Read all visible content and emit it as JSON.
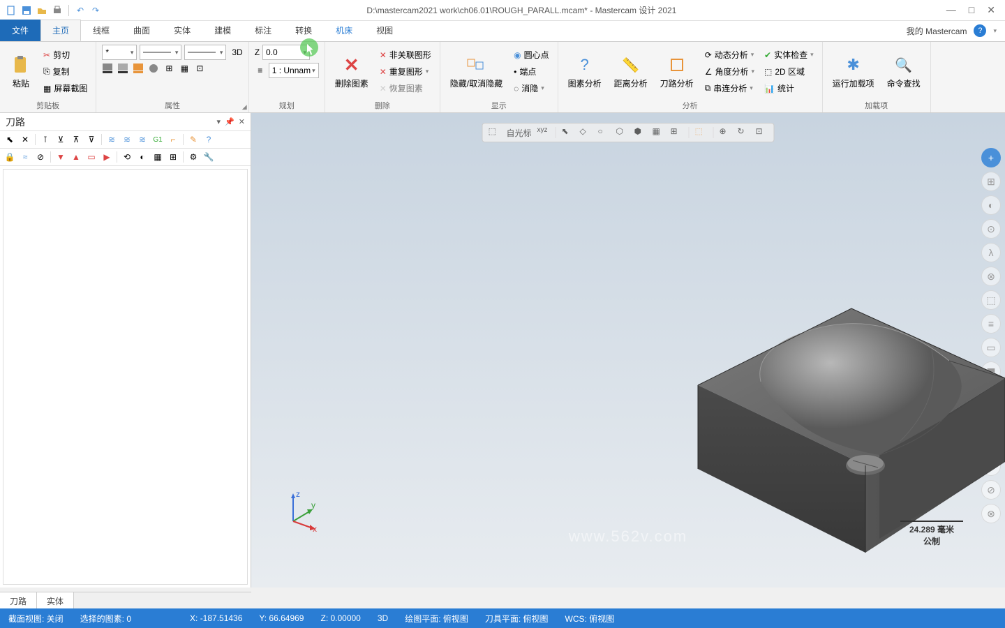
{
  "title": "D:\\mastercam2021 work\\ch06.01\\ROUGH_PARALL.mcam* - Mastercam 设计 2021",
  "qat_icons": {
    "new": "new-icon",
    "save": "save-icon",
    "open": "open-icon",
    "print": "print-icon",
    "undo": "undo-icon",
    "redo": "redo-icon"
  },
  "tabs": {
    "file": "文件",
    "home": "主页",
    "wireframe": "线框",
    "surface": "曲面",
    "solid": "实体",
    "model": "建模",
    "dim": "标注",
    "transform": "转换",
    "machine": "机床",
    "view": "视图",
    "right": "我的 Mastercam"
  },
  "ribbon": {
    "clipboard": {
      "label": "剪贴板",
      "paste": "粘贴",
      "cut": "剪切",
      "copy": "复制",
      "screenshot": "屏幕截图"
    },
    "attr": {
      "label": "属性",
      "3d": "3D"
    },
    "plan": {
      "label": "规划",
      "z": "Z",
      "zval": "0.0",
      "layer": "1 : Unnam"
    },
    "delete": {
      "label": "删除",
      "del": "删除图素",
      "nonassoc": "非关联图形",
      "dup": "重复图形",
      "restore": "恢复图素"
    },
    "show": {
      "label": "显示",
      "hide": "隐藏/取消隐藏",
      "center": "圆心点",
      "endpoint": "端点",
      "blank": "消隐"
    },
    "analyze": {
      "label": "分析",
      "elem": "图素分析",
      "dist": "距离分析",
      "tool": "刀路分析",
      "dyn": "动态分析",
      "angle": "角度分析",
      "chain": "串连分析",
      "check": "实体检查",
      "region": "2D 区域",
      "stats": "统计"
    },
    "addon": {
      "label": "加载项",
      "run": "运行加载项",
      "cmd": "命令查找"
    }
  },
  "panel": {
    "title": "刀路"
  },
  "bottom_tabs": {
    "toolpath": "刀路",
    "solid": "实体"
  },
  "float_toolbar": {
    "cursor": "自光标",
    "xyz": "xyz"
  },
  "scale": {
    "value": "24.289 毫米",
    "unit": "公制"
  },
  "watermark": "www.562v.com",
  "status": {
    "section": "截面视图: 关闭",
    "selected": "选择的图素: 0",
    "x": "X:   -187.51436",
    "y": "Y:    66.64969",
    "z": "Z:    0.00000",
    "mode": "3D",
    "cplane": "绘图平面: 俯视图",
    "tplane": "刀具平面: 俯视图",
    "wcs": "WCS: 俯视图"
  },
  "triad": {
    "x": "x",
    "y": "y",
    "z": "z"
  }
}
